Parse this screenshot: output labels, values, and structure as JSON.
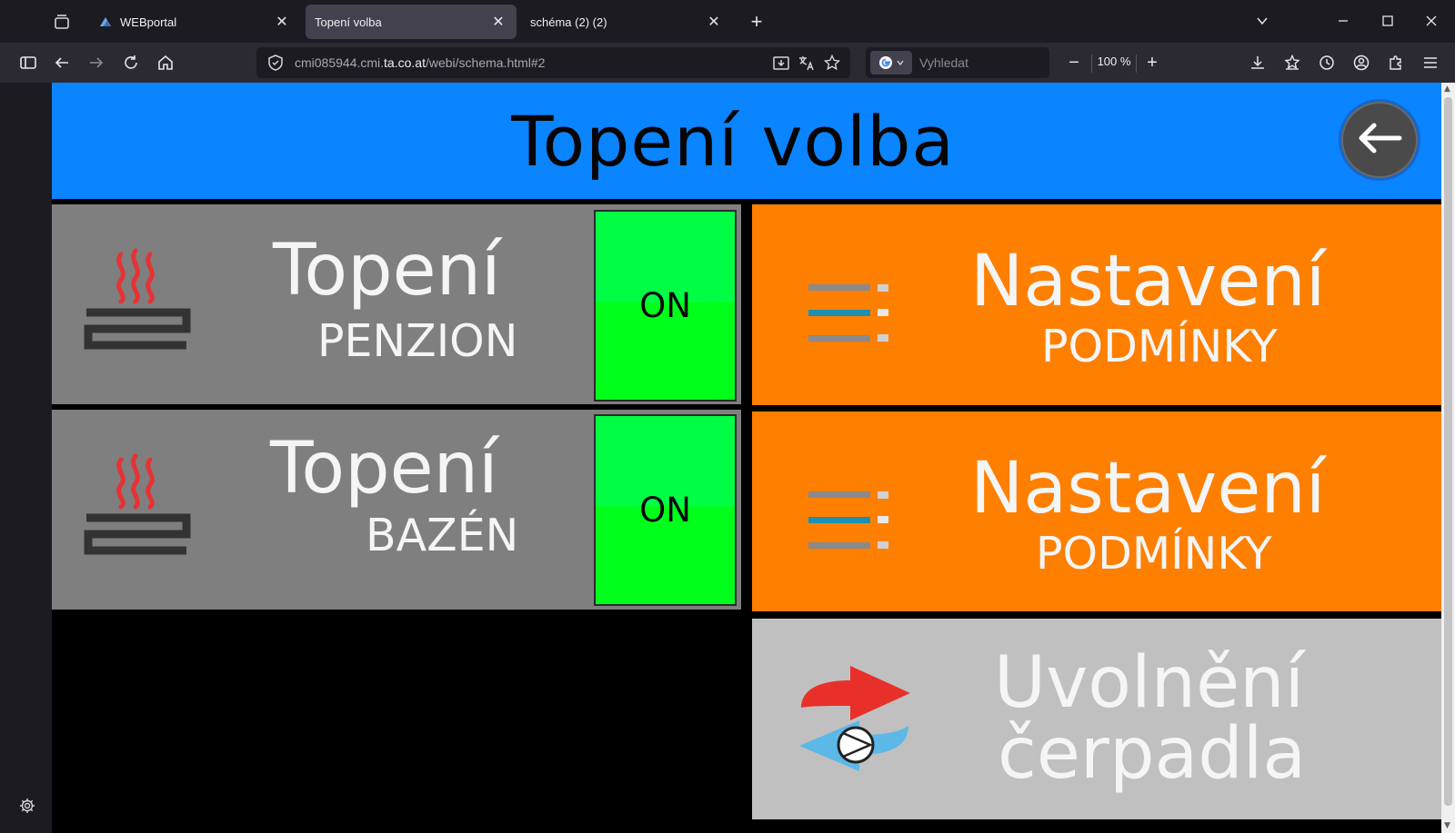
{
  "browser": {
    "tabs": [
      {
        "label": "WEBportal",
        "active": false
      },
      {
        "label": "Topení volba",
        "active": true
      },
      {
        "label": "schéma (2) (2)",
        "active": false
      }
    ],
    "url_prefix": "cmi085944.cmi.",
    "url_domain": "ta.co.at",
    "url_suffix": "/webi/schema.html#2",
    "search_placeholder": "Vyhledat",
    "zoom": "100 %"
  },
  "page": {
    "title": "Topení volba",
    "tiles": {
      "heat_penzion": {
        "title": "Topení",
        "subtitle": "PENZION",
        "state": "ON"
      },
      "heat_bazen": {
        "title": "Topení",
        "subtitle": "BAZÉN",
        "state": "ON"
      },
      "settings_1": {
        "title": "Nastavení",
        "subtitle": "PODMÍNKY"
      },
      "settings_2": {
        "title": "Nastavení",
        "subtitle": "PODMÍNKY"
      },
      "pump": {
        "line1": "Uvolnění",
        "line2": "čerpadla"
      }
    }
  },
  "colors": {
    "header": "#0a84ff",
    "tile_grey": "#7f7f7f",
    "tile_orange": "#ff7f00",
    "tile_light": "#c0c0c0",
    "on_green": "#00ff22",
    "heat_red": "#e53333"
  },
  "icons": [
    "tab-list-icon",
    "favicon-icon",
    "close-icon",
    "plus-icon",
    "chevron-down-icon",
    "minimize-icon",
    "maximize-icon",
    "sidebar-icon",
    "back-icon",
    "forward-icon",
    "reload-icon",
    "home-icon",
    "shield-icon",
    "reader-mode-icon",
    "translate-icon",
    "star-icon",
    "google-icon",
    "download-icon",
    "bookmarks-icon",
    "history-icon",
    "account-icon",
    "extensions-icon",
    "menu-icon",
    "gear-icon",
    "arrow-left-icon",
    "heater-icon",
    "list-settings-icon",
    "pump-icon"
  ]
}
